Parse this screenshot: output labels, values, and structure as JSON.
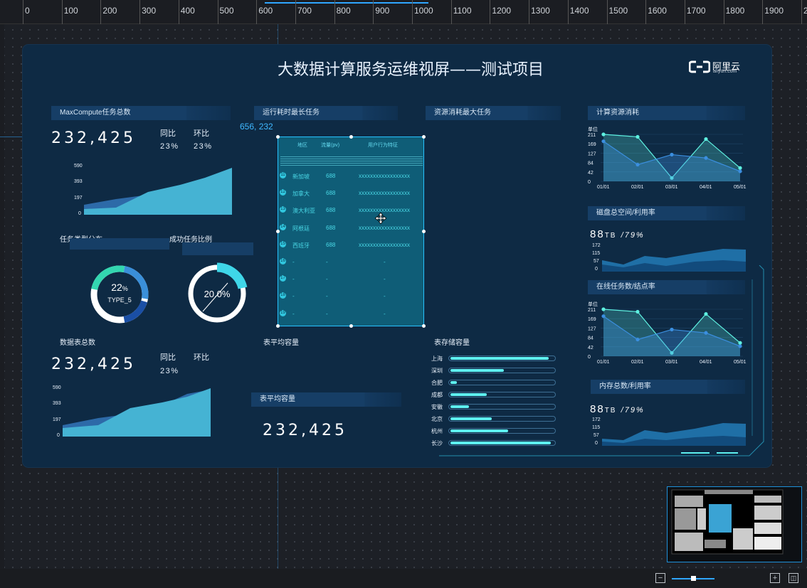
{
  "ruler": {
    "ticks": [
      "0",
      "100",
      "200",
      "300",
      "400",
      "500",
      "600",
      "700",
      "800",
      "900",
      "1000",
      "1100",
      "1200",
      "1300",
      "1400",
      "1500",
      "1600",
      "1700",
      "1800",
      "1900",
      "2"
    ]
  },
  "cursor_readout": "656, 232",
  "screen": {
    "title": "大数据计算服务运维视屏——测试项目",
    "logo_text": "阿里云",
    "logo_sub": "aliyun.com"
  },
  "panels": {
    "maxcompute": {
      "title": "MaxCompute任务总数",
      "value": "232,425",
      "yoy_label": "同比",
      "mom_label": "环比",
      "yoy": "23%",
      "mom": "23%",
      "chart_data": {
        "type": "area",
        "y_ticks": [
          "590",
          "393",
          "197",
          "0"
        ]
      }
    },
    "longest_task": {
      "title": "运行耗时最长任务"
    },
    "resource_task": {
      "title": "资源消耗最大任务"
    },
    "compute_resource": {
      "title": "计算资源消耗",
      "chart_data": {
        "type": "line",
        "unit": "单位",
        "y_ticks": [
          "211",
          "169",
          "127",
          "84",
          "42",
          "0"
        ],
        "x": [
          "01/01",
          "02/01",
          "03/01",
          "04/01",
          "05/01"
        ],
        "series": [
          {
            "values": [
              211,
              200,
              15,
              190,
              60
            ]
          },
          {
            "values": [
              180,
              75,
              120,
              105,
              45
            ]
          }
        ]
      }
    },
    "task_type": {
      "title": "任务类型分布",
      "pct": "22",
      "pct_unit": "%",
      "type_label": "TYPE_5"
    },
    "success_ratio": {
      "title": "成功任务比例",
      "value": "20.0%"
    },
    "table": {
      "headers": [
        "地区",
        "流量(pv)",
        "用户行为特征"
      ],
      "rows": [
        {
          "n": "11",
          "region": "新加坡",
          "flow": "688",
          "feature": "xxxxxxxxxxxxxxxxxx"
        },
        {
          "n": "12",
          "region": "加拿大",
          "flow": "688",
          "feature": "xxxxxxxxxxxxxxxxxx"
        },
        {
          "n": "13",
          "region": "澳大利亚",
          "flow": "688",
          "feature": "xxxxxxxxxxxxxxxxxx"
        },
        {
          "n": "14",
          "region": "阿根廷",
          "flow": "688",
          "feature": "xxxxxxxxxxxxxxxxxx"
        },
        {
          "n": "15",
          "region": "西班牙",
          "flow": "688",
          "feature": "xxxxxxxxxxxxxxxxxx"
        },
        {
          "n": "16",
          "region": "-",
          "flow": "-",
          "feature": "-"
        },
        {
          "n": "17",
          "region": "-",
          "flow": "-",
          "feature": "-"
        },
        {
          "n": "18",
          "region": "-",
          "flow": "-",
          "feature": "-"
        },
        {
          "n": "19",
          "region": "-",
          "flow": "-",
          "feature": "-"
        }
      ]
    },
    "disk": {
      "title": "磁盘总空间/利用率",
      "value": "88",
      "unit": "TB",
      "rate": "/79%",
      "chart_data": {
        "type": "area",
        "y_ticks": [
          "172",
          "115",
          "57",
          "0"
        ]
      }
    },
    "online_tasks": {
      "title": "在线任务数/结点率",
      "chart_data": {
        "type": "line",
        "unit": "单位",
        "y_ticks": [
          "211",
          "169",
          "127",
          "84",
          "42",
          "0"
        ],
        "x": [
          "01/01",
          "02/01",
          "03/01",
          "04/01",
          "05/01"
        ],
        "series": [
          {
            "values": [
              211,
              200,
              15,
              190,
              60
            ]
          },
          {
            "values": [
              180,
              75,
              120,
              105,
              45
            ]
          }
        ]
      }
    },
    "table_count": {
      "title": "数据表总数",
      "value": "232,425",
      "yoy_label": "同比",
      "mom_label": "环比",
      "yoy": "23%",
      "chart_data": {
        "type": "area",
        "y_ticks": [
          "590",
          "393",
          "197",
          "0"
        ]
      }
    },
    "avg_capacity_a": {
      "title": "表平均容量"
    },
    "avg_capacity_b": {
      "title": "表平均容量",
      "value": "232,425"
    },
    "storage": {
      "title": "表存储容量",
      "chart_data": {
        "type": "bar",
        "categories": [
          "上海",
          "深圳",
          "合肥",
          "成都",
          "安徽",
          "北京",
          "杭州",
          "长沙"
        ],
        "values": [
          95,
          52,
          6,
          35,
          18,
          40,
          56,
          97
        ]
      }
    },
    "memory": {
      "title": "内存总数/利用率",
      "value": "88",
      "unit": "TB",
      "rate": "/79%",
      "chart_data": {
        "type": "area",
        "y_ticks": [
          "172",
          "115",
          "57",
          "0"
        ]
      }
    }
  },
  "colors": {
    "accent": "#27c2ff",
    "teal": "#5ef0f0",
    "panel": "#163e66",
    "screen_bg": "#0e2a44"
  }
}
